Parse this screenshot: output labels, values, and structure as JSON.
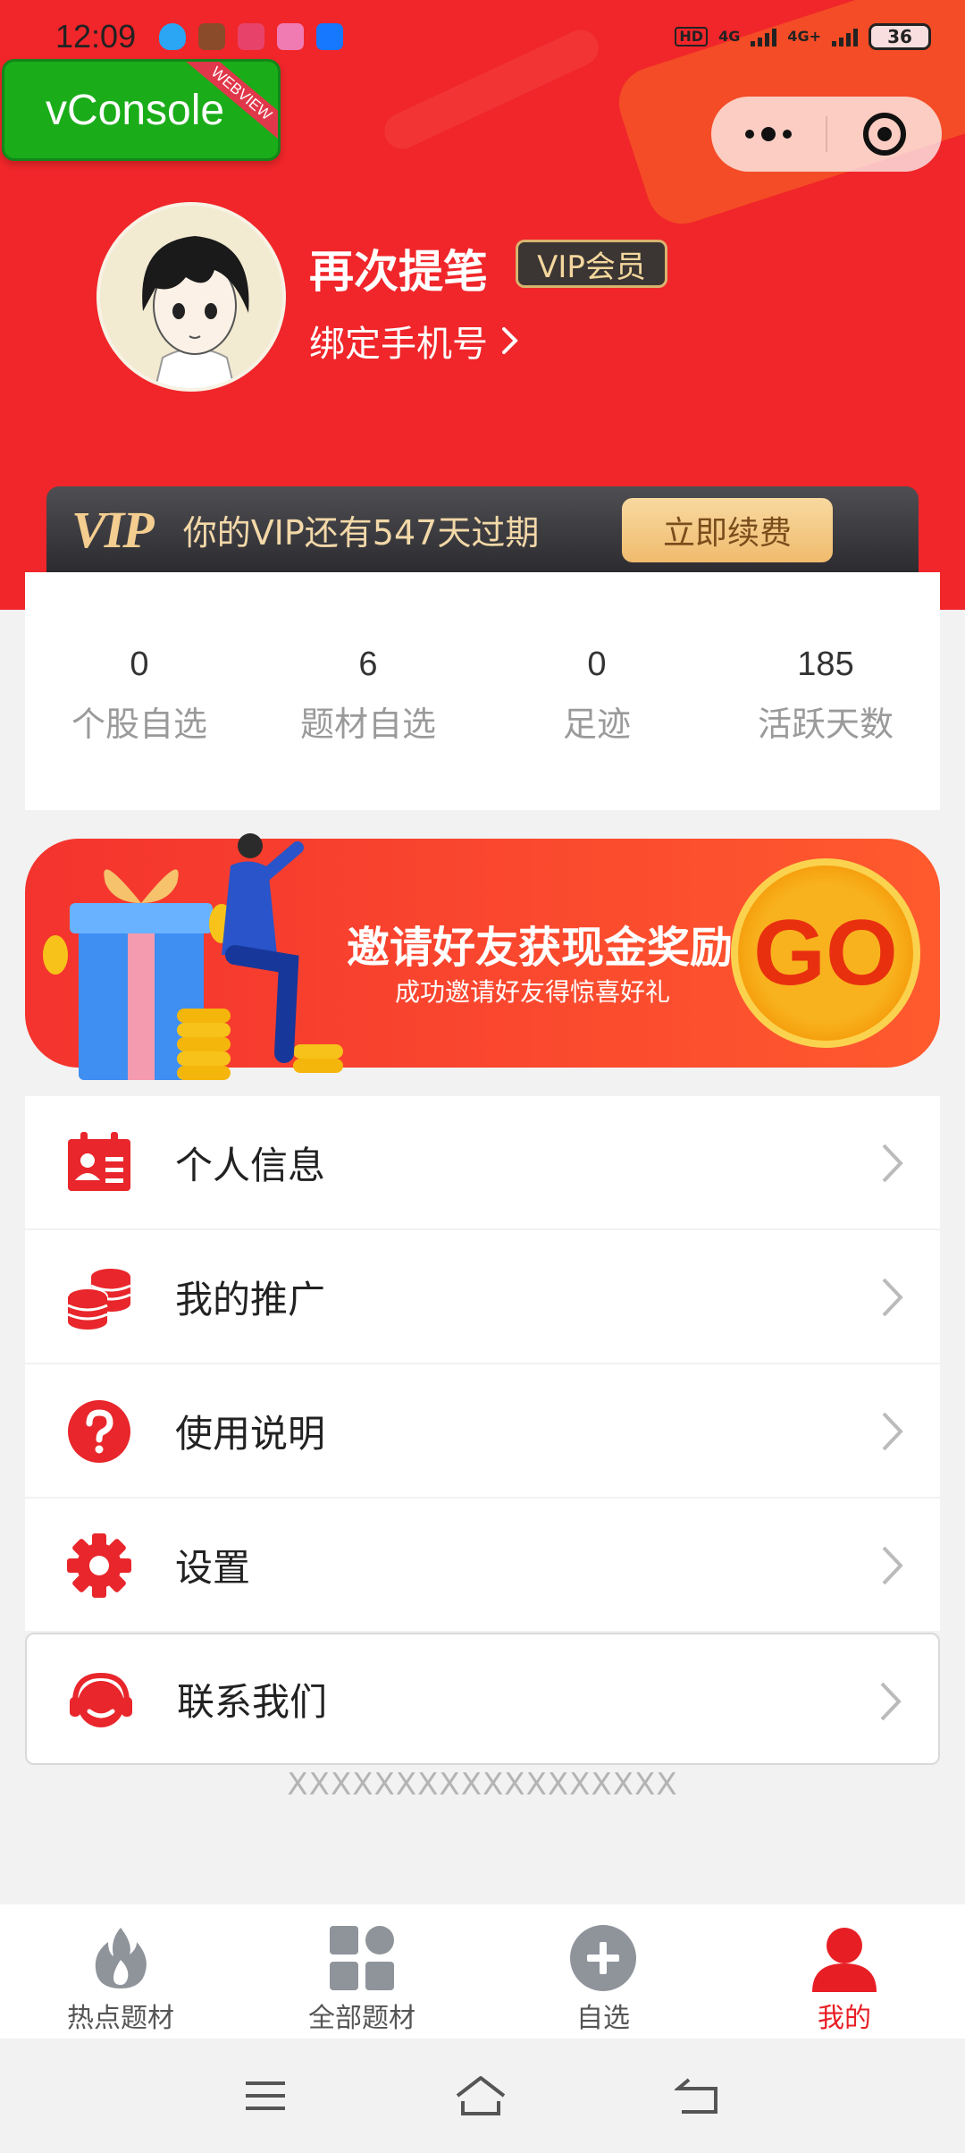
{
  "status_bar": {
    "time": "12:09",
    "network_1": "4G",
    "network_2": "4G+",
    "hd": "HD",
    "battery": "36"
  },
  "vconsole": {
    "label": "vConsole",
    "ribbon": "WEBVIEW"
  },
  "profile": {
    "name": "再次提笔",
    "badge": "VIP会员",
    "bind_phone": "绑定手机号",
    "chevron": "›"
  },
  "vip_bar": {
    "logo": "VIP",
    "text": "你的VIP还有547天过期",
    "button": "立即续费"
  },
  "stats": [
    {
      "value": "0",
      "label": "个股自选"
    },
    {
      "value": "6",
      "label": "题材自选"
    },
    {
      "value": "0",
      "label": "足迹"
    },
    {
      "value": "185",
      "label": "活跃天数"
    }
  ],
  "banner": {
    "title": "邀请好友获现金奖励",
    "subtitle": "成功邀请好友得惊喜好礼",
    "go": "GO"
  },
  "menu": [
    {
      "label": "个人信息",
      "icon": "id-card-icon"
    },
    {
      "label": "我的推广",
      "icon": "coins-stack-icon"
    },
    {
      "label": "使用说明",
      "icon": "question-icon"
    },
    {
      "label": "设置",
      "icon": "gear-icon"
    },
    {
      "label": "联系我们",
      "icon": "headset-icon"
    }
  ],
  "footer": "XXXXXXXXXXXXXXXXXX",
  "tabs": [
    {
      "label": "热点题材",
      "icon": "flame-icon"
    },
    {
      "label": "全部题材",
      "icon": "grid-icon"
    },
    {
      "label": "自选",
      "icon": "plus-circle-icon"
    },
    {
      "label": "我的",
      "icon": "user-icon",
      "active": true
    }
  ],
  "colors": {
    "brand_red": "#f0262a",
    "active_tab": "#e81e25",
    "vip_gold": "#f3d8a8"
  }
}
